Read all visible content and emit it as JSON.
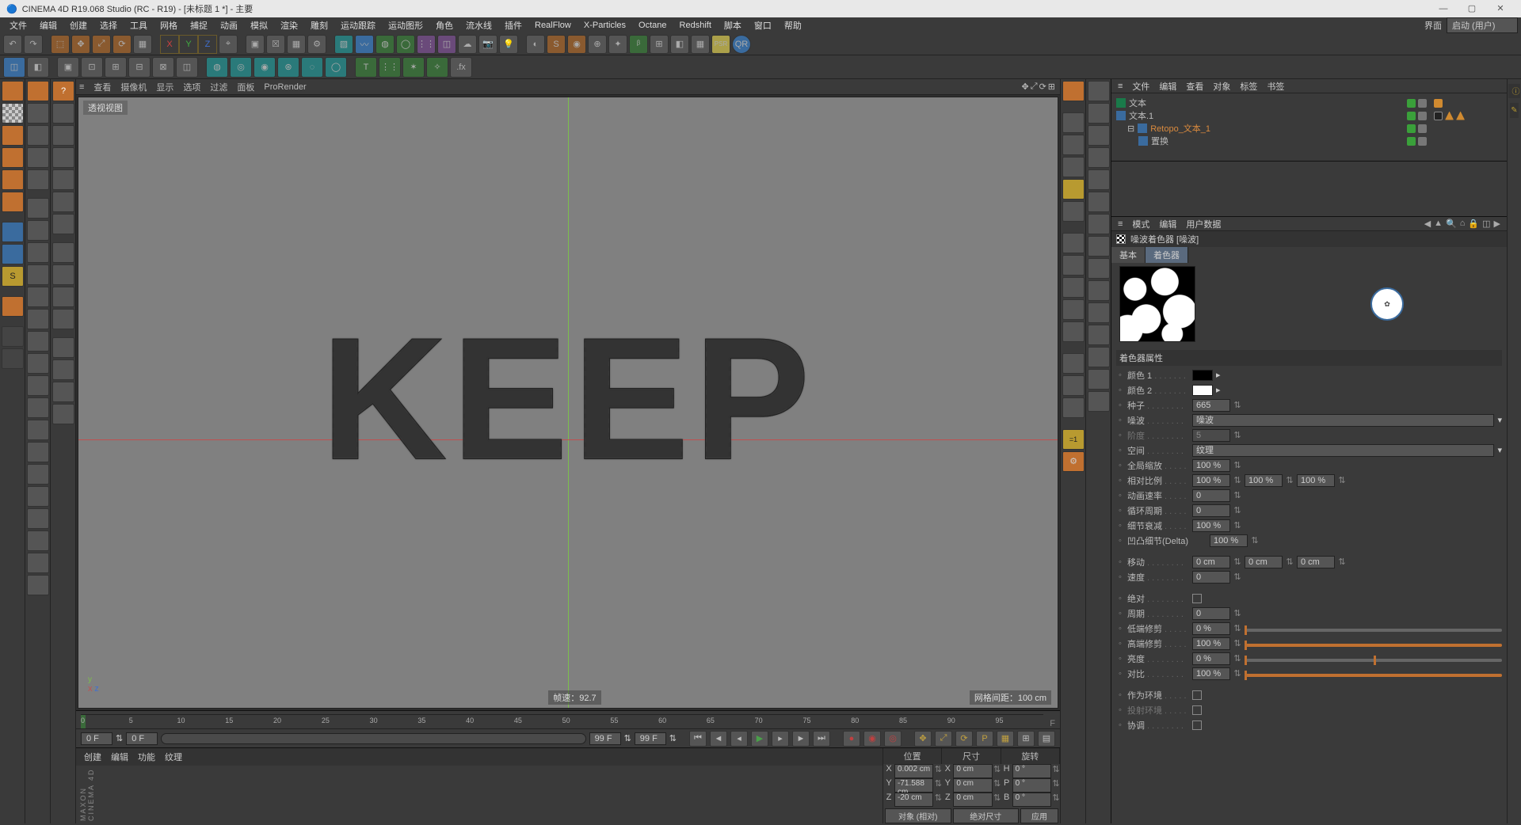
{
  "titlebar": {
    "app": "CINEMA 4D R19.068 Studio (RC - R19) - [未标题 1 *] - 主要"
  },
  "menu": [
    "文件",
    "编辑",
    "创建",
    "选择",
    "工具",
    "网格",
    "捕捉",
    "动画",
    "模拟",
    "渲染",
    "雕刻",
    "运动跟踪",
    "运动图形",
    "角色",
    "流水线",
    "插件",
    "RealFlow",
    "X-Particles",
    "Octane",
    "Redshift",
    "脚本",
    "窗口",
    "帮助"
  ],
  "layout": {
    "label": "界面",
    "value": "启动 (用户)"
  },
  "view_tabs": [
    "查看",
    "摄像机",
    "显示",
    "选项",
    "过滤",
    "面板",
    "ProRender"
  ],
  "viewport": {
    "name": "透视视图",
    "text3d": "KEEP",
    "fps_label": "帧速：",
    "fps": "92.7",
    "grid_label": "网格间距：",
    "grid": "100 cm"
  },
  "obj_mgr": {
    "menu": [
      "文件",
      "编辑",
      "查看",
      "对象",
      "标签",
      "书签"
    ],
    "items": [
      {
        "name": "文本",
        "icon": "text",
        "indent": 0
      },
      {
        "name": "文本.1",
        "icon": "hier",
        "indent": 0
      },
      {
        "name": "Retopo_文本_1",
        "icon": "hier",
        "indent": 1,
        "selected": true
      },
      {
        "name": "置换",
        "icon": "disp",
        "indent": 2
      }
    ]
  },
  "attr": {
    "menu": [
      "模式",
      "编辑",
      "用户数据"
    ],
    "title": "噪波着色器 [噪波]",
    "tabs": [
      "基本",
      "着色器"
    ],
    "section": "着色器属性",
    "props": {
      "color1": {
        "label": "颜色 1",
        "hex": "#000000"
      },
      "color2": {
        "label": "颜色 2",
        "hex": "#ffffff"
      },
      "seed": {
        "label": "种子",
        "value": "665"
      },
      "noise": {
        "label": "噪波",
        "value": "噪波"
      },
      "octaves": {
        "label": "阶度",
        "value": "5"
      },
      "space": {
        "label": "空间",
        "value": "纹理"
      },
      "gscale": {
        "label": "全局缩放",
        "value": "100 %"
      },
      "rel": {
        "label": "相对比例",
        "v1": "100 %",
        "v2": "100 %",
        "v3": "100 %"
      },
      "aspeed": {
        "label": "动画速率",
        "value": "0"
      },
      "cycle": {
        "label": "循环周期",
        "value": "0"
      },
      "detail": {
        "label": "细节衰减",
        "value": "100 %"
      },
      "delta": {
        "label": "凹凸细节(Delta)",
        "value": "100 %"
      },
      "move": {
        "label": "移动",
        "v1": "0 cm",
        "v2": "0 cm",
        "v3": "0 cm"
      },
      "speed": {
        "label": "速度",
        "value": "0"
      },
      "abs": {
        "label": "绝对"
      },
      "period": {
        "label": "周期",
        "value": "0"
      },
      "lowclip": {
        "label": "低端修剪",
        "value": "0 %"
      },
      "highclip": {
        "label": "高端修剪",
        "value": "100 %"
      },
      "bright": {
        "label": "亮度",
        "value": "0 %"
      },
      "contrast": {
        "label": "对比",
        "value": "100 %"
      },
      "useenv": {
        "label": "作为环境"
      },
      "projenv": {
        "label": "投射环境"
      },
      "compat": {
        "label": "协调"
      }
    }
  },
  "timeline": {
    "start": "0 F",
    "cur": "0 F",
    "end1": "99 F",
    "end2": "99 F",
    "ticks": [
      "0",
      "5",
      "10",
      "15",
      "20",
      "25",
      "30",
      "35",
      "40",
      "45",
      "50",
      "55",
      "60",
      "65",
      "70",
      "75",
      "80",
      "85",
      "90",
      "95"
    ]
  },
  "material_tabs": [
    "创建",
    "编辑",
    "功能",
    "纹理"
  ],
  "maxon": "MAXON CINEMA 4D",
  "coord": {
    "headers": [
      "位置",
      "尺寸",
      "旋转"
    ],
    "rows": [
      {
        "ax": "X",
        "p": "0.002 cm",
        "s": "0 cm",
        "r": "0 °",
        "rl": "H"
      },
      {
        "ax": "Y",
        "p": "-71.588 cm",
        "s": "0 cm",
        "r": "0 °",
        "rl": "P"
      },
      {
        "ax": "Z",
        "p": "-20 cm",
        "s": "0 cm",
        "r": "0 °",
        "rl": "B"
      }
    ],
    "mode1": "对象 (相对)",
    "mode2": "绝对尺寸",
    "apply": "应用"
  }
}
